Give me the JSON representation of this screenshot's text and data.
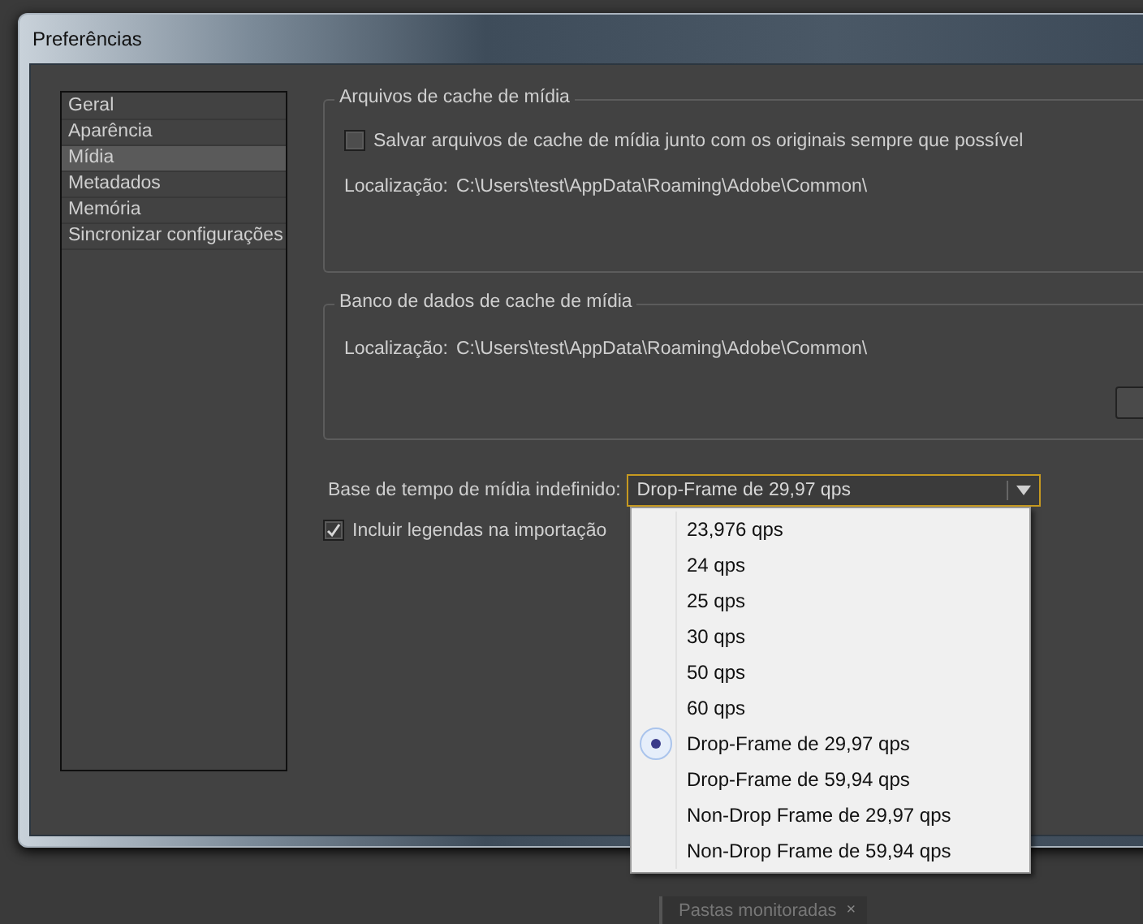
{
  "background": {
    "tab": {
      "label": "Pastas monitoradas",
      "close": "×"
    }
  },
  "window": {
    "title": "Preferências"
  },
  "sidebar": {
    "items": [
      {
        "label": "Geral",
        "selected": false
      },
      {
        "label": "Aparência",
        "selected": false
      },
      {
        "label": "Mídia",
        "selected": true
      },
      {
        "label": "Metadados",
        "selected": false
      },
      {
        "label": "Memória",
        "selected": false
      },
      {
        "label": "Sincronizar configurações",
        "selected": false
      }
    ]
  },
  "groups": [
    {
      "title": "Arquivos de cache de mídia",
      "checkbox": {
        "label": "Salvar arquivos de cache de mídia junto com os originais sempre que possível",
        "checked": false
      },
      "location_label": "Localização:",
      "location": "C:\\Users\\test\\AppData\\Roaming\\Adobe\\Common\\"
    },
    {
      "title": "Banco de dados de cache de mídia",
      "location_label": "Localização:",
      "location": "C:\\Users\\test\\AppData\\Roaming\\Adobe\\Common\\"
    }
  ],
  "timebase": {
    "label": "Base de tempo de mídia indefinido:",
    "value": "Drop-Frame de 29,97 qps",
    "expanded": true,
    "options": [
      {
        "label": "23,976 qps",
        "selected": false
      },
      {
        "label": "24 qps",
        "selected": false
      },
      {
        "label": "25 qps",
        "selected": false
      },
      {
        "label": "30 qps",
        "selected": false
      },
      {
        "label": "50 qps",
        "selected": false
      },
      {
        "label": "60 qps",
        "selected": false
      },
      {
        "label": "Drop-Frame de 29,97 qps",
        "selected": true
      },
      {
        "label": "Drop-Frame de 59,94 qps",
        "selected": false
      },
      {
        "label": "Non-Drop Frame de 29,97 qps",
        "selected": false
      },
      {
        "label": "Non-Drop Frame de 59,94 qps",
        "selected": false
      }
    ]
  },
  "captions": {
    "label": "Incluir legendas na importação",
    "checked": true
  }
}
